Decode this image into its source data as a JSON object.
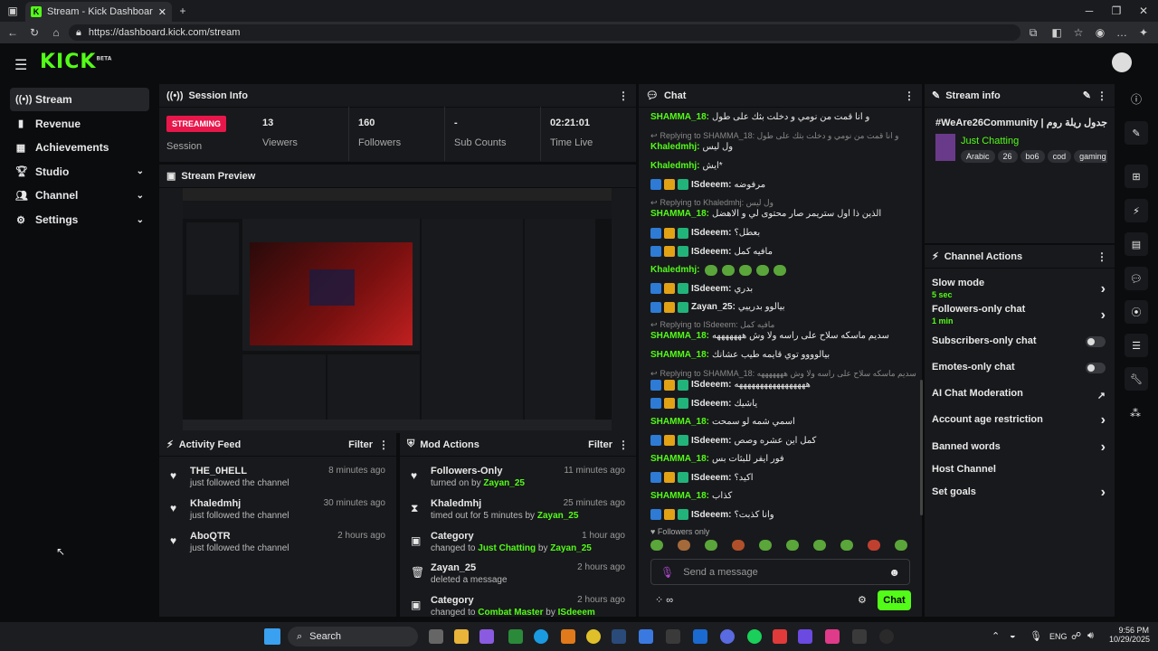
{
  "browser": {
    "tab_title": "Stream - Kick Dashboard",
    "url": "https://dashboard.kick.com/stream"
  },
  "logo": {
    "text": "KICK",
    "tag": "BETA"
  },
  "sidebar": {
    "items": [
      {
        "label": "Stream",
        "icon": "broadcast-icon"
      },
      {
        "label": "Revenue",
        "icon": "chart-icon"
      },
      {
        "label": "Achievements",
        "icon": "medal-icon"
      },
      {
        "label": "Studio",
        "icon": "trophy-icon"
      },
      {
        "label": "Channel",
        "icon": "people-icon"
      },
      {
        "label": "Settings",
        "icon": "gear-icon"
      }
    ]
  },
  "session_info": {
    "title": "Session Info",
    "status": "STREAMING",
    "session_label": "Session",
    "stats": [
      {
        "value": "13",
        "label": "Viewers"
      },
      {
        "value": "160",
        "label": "Followers"
      },
      {
        "value": "-",
        "label": "Sub Counts"
      },
      {
        "value": "02:21:01",
        "label": "Time Live"
      }
    ]
  },
  "stream_preview": {
    "title": "Stream Preview"
  },
  "activity_feed": {
    "title": "Activity Feed",
    "filter": "Filter",
    "items": [
      {
        "name": "THE_0HELL",
        "desc": "just followed the channel",
        "time": "8 minutes ago"
      },
      {
        "name": "Khaledmhj",
        "desc": "just followed the channel",
        "time": "30 minutes ago"
      },
      {
        "name": "AboQTR",
        "desc": "just followed the channel",
        "time": "2 hours ago"
      }
    ]
  },
  "mod_actions": {
    "title": "Mod Actions",
    "filter": "Filter",
    "items": [
      {
        "name": "Followers-Only",
        "pre": "turned on by ",
        "hl": "Zayan_25",
        "mid": "",
        "hl2": "",
        "time": "11 minutes ago"
      },
      {
        "name": "Khaledmhj",
        "pre": "timed out for 5 minutes by ",
        "hl": "Zayan_25",
        "mid": "",
        "hl2": "",
        "time": "25 minutes ago"
      },
      {
        "name": "Category",
        "pre": "changed to ",
        "hl": "Just Chatting",
        "mid": " by ",
        "hl2": "Zayan_25",
        "time": "1 hour ago"
      },
      {
        "name": "Zayan_25",
        "pre": "deleted a message",
        "hl": "",
        "mid": "",
        "hl2": "",
        "time": "2 hours ago"
      },
      {
        "name": "Category",
        "pre": "changed to ",
        "hl": "Combat Master",
        "mid": " by ",
        "hl2": "ISdeeem",
        "time": "2 hours ago"
      }
    ]
  },
  "chat": {
    "title": "Chat",
    "messages": [
      {
        "user": "SHAMMA_18:",
        "text": "و انا قمت من نومي و دخلت بثك على طول",
        "reply": ""
      },
      {
        "user": "Khaledmhj:",
        "text": "ول ليس",
        "reply": "Replying to SHAMMA_18: و انا قمت من نومي و دخلت بثك على طول"
      },
      {
        "user": "Khaledmhj:",
        "text": "ايش*",
        "reply": ""
      },
      {
        "user": "ISdeeem:",
        "text": "مرفوضه",
        "reply": ""
      },
      {
        "user": "SHAMMA_18:",
        "text": "الذين ذا اول ستريمر صار محتوى لي و الاهضل",
        "reply": "Replying to Khaledmhj: ول ليس"
      },
      {
        "user": "ISdeeem:",
        "text": "بعطل؟",
        "reply": ""
      },
      {
        "user": "ISdeeem:",
        "text": "مافيه كمل",
        "reply": ""
      },
      {
        "user": "Khaledmhj:",
        "text": "",
        "reply": ""
      },
      {
        "user": "ISdeeem:",
        "text": "بدري",
        "reply": ""
      },
      {
        "user": "Zayan_25:",
        "text": "بيالوو بدرييي",
        "reply": ""
      },
      {
        "user": "SHAMMA_18:",
        "text": "سديم ماسكه سلاح على راسه ولا وش هههههههه",
        "reply": "Replying to ISdeeem: مافيه كمل"
      },
      {
        "user": "SHAMMA_18:",
        "text": "بيالوووو توي قايمه طيب عشانك",
        "reply": ""
      },
      {
        "user": "ISdeeem:",
        "text": "هههههههههههههههههه",
        "reply": "Replying to SHAMMA_18: سديم ماسكه سلاح على راسه ولا وش هههههههه"
      },
      {
        "user": "ISdeeem:",
        "text": "ياشيك",
        "reply": ""
      },
      {
        "user": "SHAMMA_18:",
        "text": "اسمي شمه لو سمحت",
        "reply": ""
      },
      {
        "user": "ISdeeem:",
        "text": "كمل اين عشره وصص",
        "reply": ""
      },
      {
        "user": "SHAMMA_18:",
        "text": "فور ايفر للبثات بس",
        "reply": ""
      },
      {
        "user": "ISdeeem:",
        "text": "اكيد؟",
        "reply": ""
      },
      {
        "user": "SHAMMA_18:",
        "text": "كذاب",
        "reply": ""
      },
      {
        "user": "ISdeeem:",
        "text": "وانا كذبت؟",
        "reply": ""
      }
    ],
    "mode": "Followers only",
    "placeholder": "Send a message",
    "send": "Chat"
  },
  "stream_info": {
    "title": "Stream info",
    "stream_title": "#WeAre26Community | جدول ريلة روم",
    "category": "Just Chatting",
    "tags": [
      "Arabic",
      "26",
      "bo6",
      "cod",
      "gaming"
    ]
  },
  "channel_actions": {
    "title": "Channel Actions",
    "items": [
      {
        "label": "Slow mode",
        "sub": "5 sec",
        "kind": "arrow"
      },
      {
        "label": "Followers-only chat",
        "sub": "1 min",
        "kind": "arrow"
      },
      {
        "label": "Subscribers-only chat",
        "sub": "",
        "kind": "toggle"
      },
      {
        "label": "Emotes-only chat",
        "sub": "",
        "kind": "toggle"
      },
      {
        "label": "AI Chat Moderation",
        "sub": "",
        "kind": "external"
      },
      {
        "label": "Account age restriction",
        "sub": "",
        "kind": "arrow"
      },
      {
        "label": "Banned words",
        "sub": "",
        "kind": "arrow"
      },
      {
        "label": "Host Channel",
        "sub": "",
        "kind": "none"
      },
      {
        "label": "Set goals",
        "sub": "",
        "kind": "arrow"
      }
    ]
  },
  "taskbar": {
    "search": "Search",
    "lang": "ENG",
    "time": "9:56 PM",
    "date": "10/29/2025"
  },
  "colors": {
    "accent": "#53fc18",
    "live": "#e8174b",
    "panel": "#18191c",
    "bg": "#0b0c0e"
  }
}
